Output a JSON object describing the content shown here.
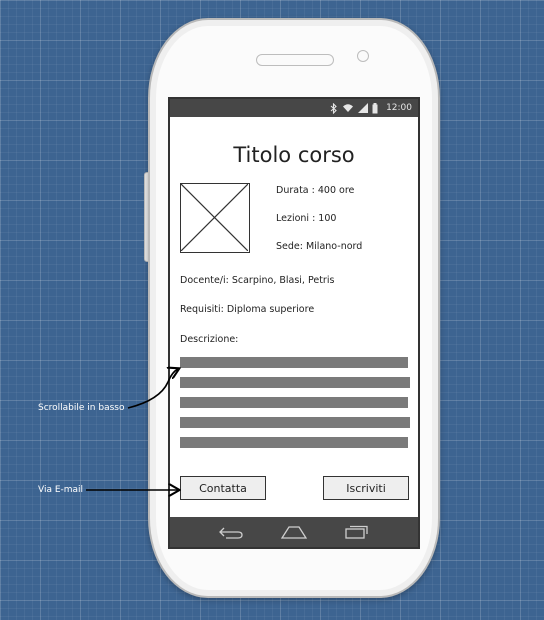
{
  "statusbar": {
    "time": "12:00",
    "icons": [
      "bluetooth-icon",
      "wifi-icon",
      "signal-icon",
      "battery-icon"
    ]
  },
  "course": {
    "title": "Titolo corso",
    "info": [
      "Durata : 400 ore",
      "Lezioni : 100",
      "Sede: Milano-nord"
    ],
    "docenti": "Docente/i: Scarpino, Blasi, Petris",
    "requisiti": "Requisiti: Diploma superiore",
    "descrizione_label": "Descrizione:"
  },
  "buttons": {
    "contatta": "Contatta",
    "iscriviti": "Iscriviti"
  },
  "navbar": {
    "icons": [
      "back-icon",
      "home-icon",
      "recent-apps-icon"
    ]
  },
  "annotations": {
    "scroll": "Scrollabile in basso",
    "email": "Via E-mail"
  },
  "colors": {
    "background": "#3d6491",
    "bars": "#474747",
    "placeholder_text": "#7a7a7a"
  }
}
